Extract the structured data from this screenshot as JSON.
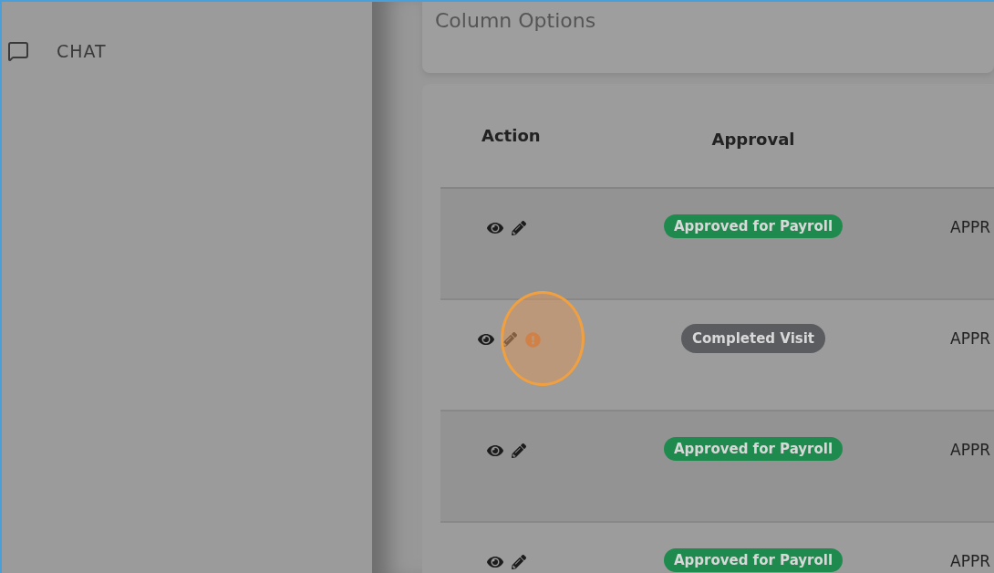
{
  "sidebar": {
    "items": [
      {
        "label": "CHAT"
      }
    ]
  },
  "column_options": {
    "label": "Column Options"
  },
  "table": {
    "columns": [
      "Action",
      "Approval"
    ],
    "rows": [
      {
        "warning": false,
        "highlighted": false,
        "status": {
          "kind": "approved",
          "label": "Approved for Payroll"
        },
        "column_3": "APPR"
      },
      {
        "warning": true,
        "highlighted": true,
        "status": {
          "kind": "completed",
          "label": "Completed Visit"
        },
        "column_3": "APPR"
      },
      {
        "warning": false,
        "highlighted": false,
        "status": {
          "kind": "approved",
          "label": "Approved for Payroll"
        },
        "column_3": "APPR"
      },
      {
        "warning": false,
        "highlighted": false,
        "status": {
          "kind": "approved",
          "label": "Approved for Payroll"
        },
        "column_3": "APPR"
      }
    ]
  }
}
